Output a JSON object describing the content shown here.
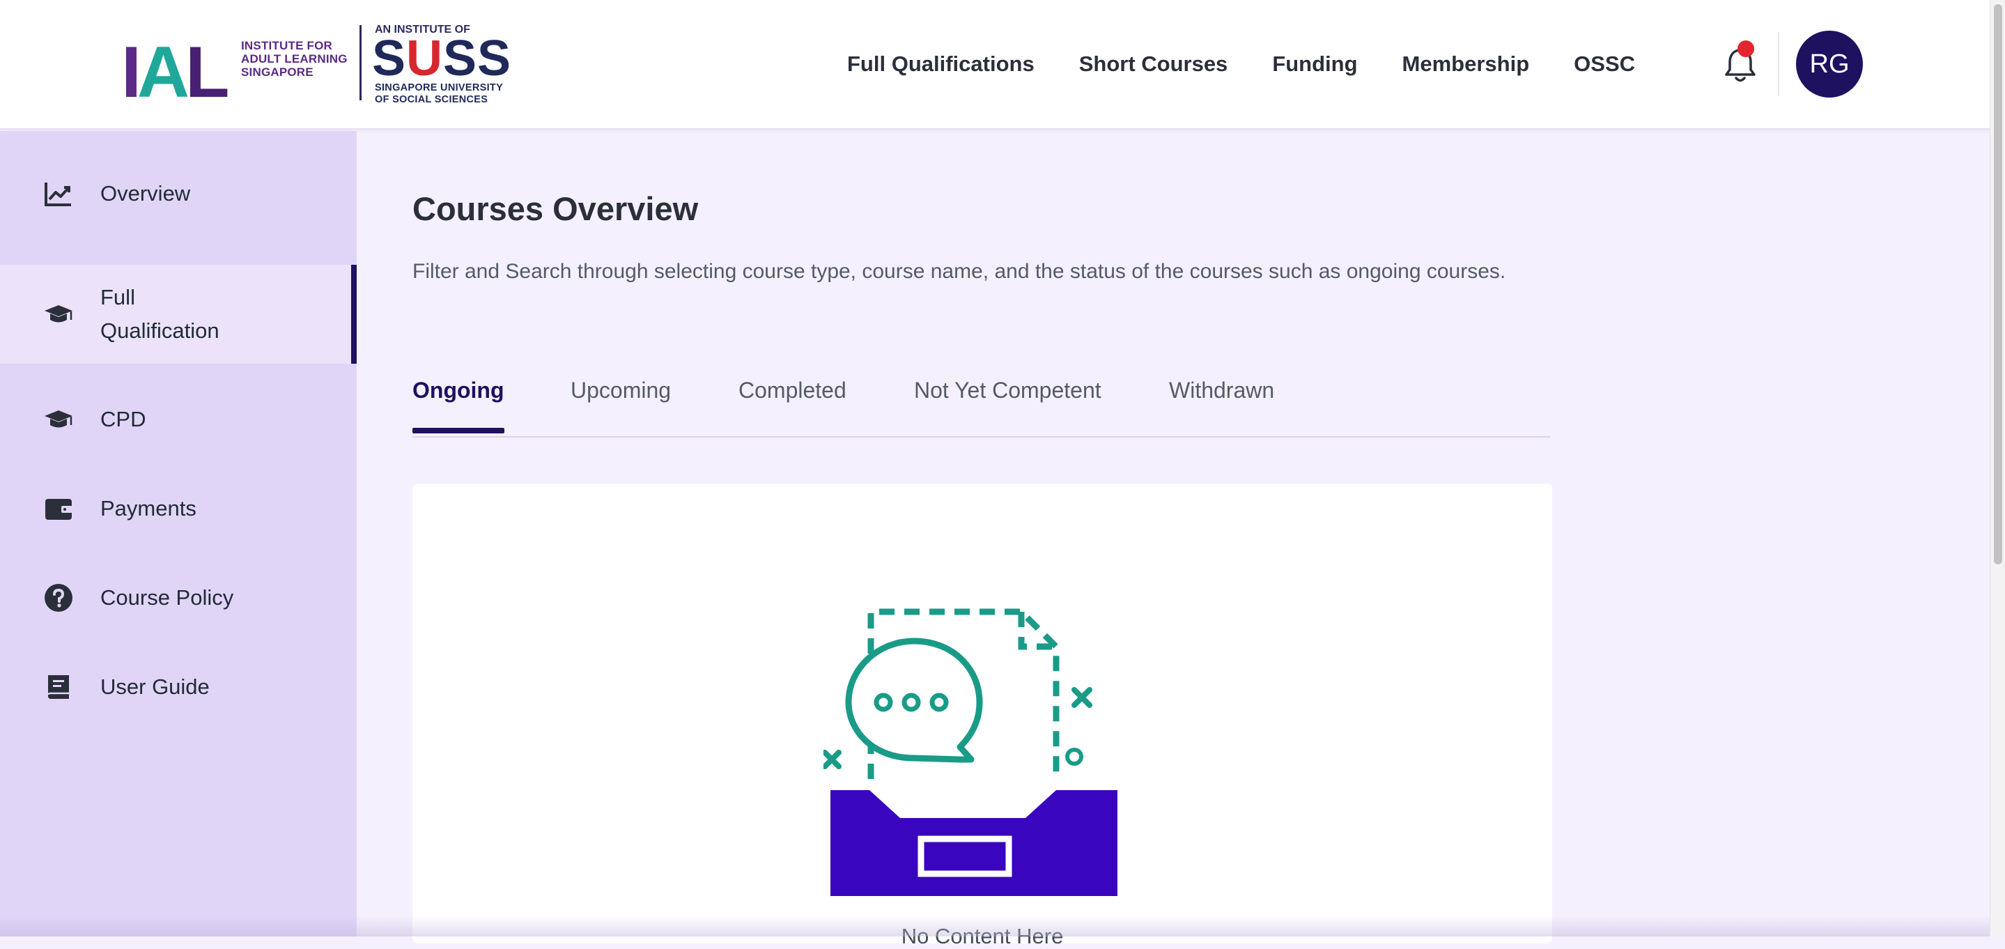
{
  "brand": {
    "ial_letters": "IAL",
    "ial_tagline": "INSTITUTE FOR ADULT LEARNING SINGAPORE",
    "suss_prefix": "AN INSTITUTE OF",
    "suss_name_s1": "S",
    "suss_name_u": "U",
    "suss_name_rest": "SS",
    "suss_sub_line1": "SINGAPORE UNIVERSITY",
    "suss_sub_line2": "OF SOCIAL SCIENCES"
  },
  "nav": {
    "items": [
      "Full Qualifications",
      "Short Courses",
      "Funding",
      "Membership",
      "OSSC"
    ]
  },
  "user": {
    "initials": "RG",
    "has_notification": true
  },
  "sidebar": {
    "items": [
      {
        "label": "Overview",
        "icon": "chart-line-icon"
      },
      {
        "label": "Full Qualification",
        "icon": "graduation-cap-icon",
        "active": true
      },
      {
        "label": "CPD",
        "icon": "graduation-cap-icon"
      },
      {
        "label": "Payments",
        "icon": "wallet-icon"
      },
      {
        "label": "Course Policy",
        "icon": "question-circle-icon"
      },
      {
        "label": "User Guide",
        "icon": "book-icon"
      }
    ]
  },
  "main": {
    "title": "Courses Overview",
    "description": "Filter and Search through selecting course type, course name, and the status of the courses such as ongoing courses.",
    "tabs": [
      {
        "label": "Ongoing",
        "active": true
      },
      {
        "label": "Upcoming"
      },
      {
        "label": "Completed"
      },
      {
        "label": "Not Yet Competent"
      },
      {
        "label": "Withdrawn"
      }
    ],
    "empty_state": {
      "text": "No Content Here",
      "icon": "empty-inbox-icon"
    }
  },
  "colors": {
    "primary": "#1e1160",
    "sidebar_bg": "#e1d5f7",
    "page_bg": "#f5f0fd",
    "illustration_teal": "#1a9b88",
    "illustration_purple": "#3a05bf",
    "notification": "#e5252d"
  }
}
